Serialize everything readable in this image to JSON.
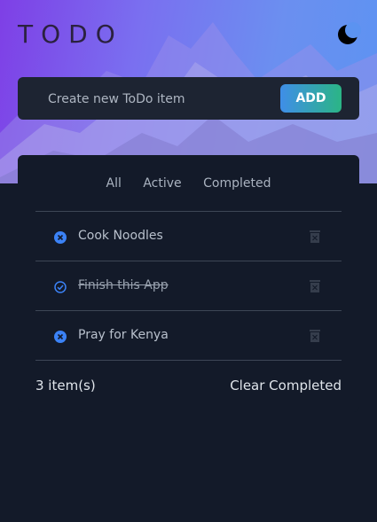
{
  "header": {
    "title": "TODO",
    "theme_icon": "moon-icon"
  },
  "new_item": {
    "placeholder": "Create new ToDo item",
    "add_label": "ADD"
  },
  "filters": [
    "All",
    "Active",
    "Completed"
  ],
  "todos": [
    {
      "text": "Cook Noodles",
      "completed": false,
      "status_icon": "x-circle-icon",
      "delete_icon": "trash-icon"
    },
    {
      "text": "Finish this App",
      "completed": true,
      "status_icon": "check-circle-icon",
      "delete_icon": "trash-icon"
    },
    {
      "text": "Pray for Kenya",
      "completed": false,
      "status_icon": "x-circle-icon",
      "delete_icon": "trash-icon"
    }
  ],
  "footer": {
    "count_label": "3 item(s)",
    "clear_label": "Clear Completed"
  },
  "colors": {
    "accent_blue": "#3b82f6",
    "add_gradient_start": "#3f8ee8",
    "add_gradient_end": "#2bb585",
    "background": "#131a29"
  }
}
